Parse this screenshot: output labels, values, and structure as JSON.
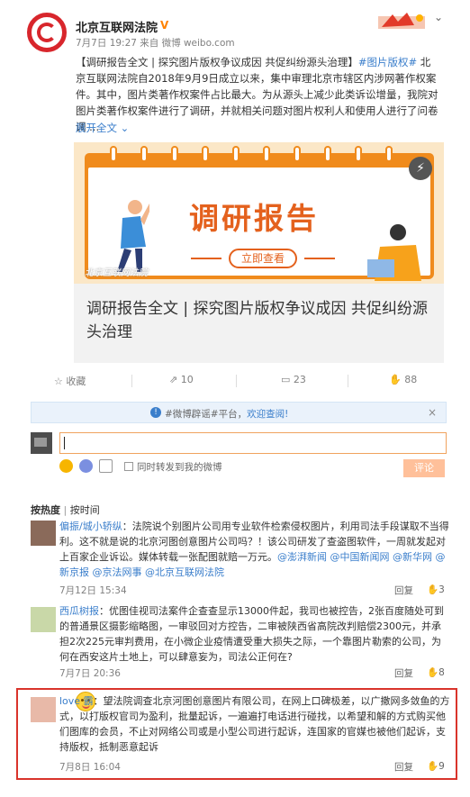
{
  "post": {
    "author": "北京互联网法院",
    "verified": "V",
    "time": "7月7日 19:27 来自 微博 weibo.com",
    "text_1": "【调研报告全文 | 探究图片版权争议成因 共促纠纷源头治理】",
    "hashtag": "#图片版权#",
    "text_2": " 北京互联网法院自2018年9月9日成立以来，集中审理北京市辖区内涉网著作权案件。其中，图片类著作权案件占比最大。为从源头上减少此类诉讼增量，我院对图片类著作权案件进行了调研，并就相关问题对图片权利人和使用人进行了问卷调 ...",
    "expand": "展开全文 ⌄"
  },
  "card": {
    "banner_title": "调研报告",
    "banner_button": "立即查看",
    "watermark": "北京互联网法院",
    "title": "调研报告全文 | 探究图片版权争议成因 共促纠纷源头治理"
  },
  "actions": {
    "favorite": "☆ 收藏",
    "repost": "⇗ 10",
    "comment": "▭ 23",
    "like": "88"
  },
  "comment_box": {
    "notice_prefix": "#微博辟谣#平台，",
    "notice_link": "欢迎查阅!",
    "close": "×",
    "repost_label": "同时转发到我的微博",
    "submit": "评论"
  },
  "sort": {
    "hot": "按热度",
    "time": "按时间"
  },
  "comments": [
    {
      "name": "偏振/城小轿纵",
      "text": "：法院说个别图片公司用专业软件检索侵权图片，利用司法手段谋取不当得利。这不就是说的北京河图创意图片公司吗？！该公司研发了查盗图软件，一周就发起对上百家企业诉讼。媒体转载一张配图就赔一万元。",
      "mentions": "@澎湃新闻 @中国新闻网 @新华网 @新京报 @京法网事 @北京互联网法院",
      "date": "7月12日 15:34",
      "reply": "回复",
      "likes": "3"
    },
    {
      "name": "西瓜树报",
      "text": "：优图佳视司法案件企查查显示13000件起，我司也被控告，2张百度随处可到的普通景区摄影缩略图，一审驳回对方控告，二审被陕西省高院改判赔偿2300元，并承担2次225元审判费用，在小微企业疫情遭受重大损失之际，一个靠图片勒索的公司，为何在西安这片土地上，可以肆意妄为，司法公正何在?",
      "date": "7月7日 20:36",
      "reply": "回复",
      "likes": "8"
    },
    {
      "name": "love  霸",
      "text": "：望法院调查北京河图创意图片有限公司，在网上口碑极差，以广撒网多敛鱼的方式，以打版权官司为盈利，批量起诉，一遍遍打电话进行碰找，以希望和解的方式购买他们图库的会员，不止对网络公司或是小型公司进行起诉，连国家的官媒也被他们起诉，支持版权，抵制恶意起诉",
      "date": "7月8日 16:04",
      "reply": "回复",
      "likes": "9"
    }
  ]
}
